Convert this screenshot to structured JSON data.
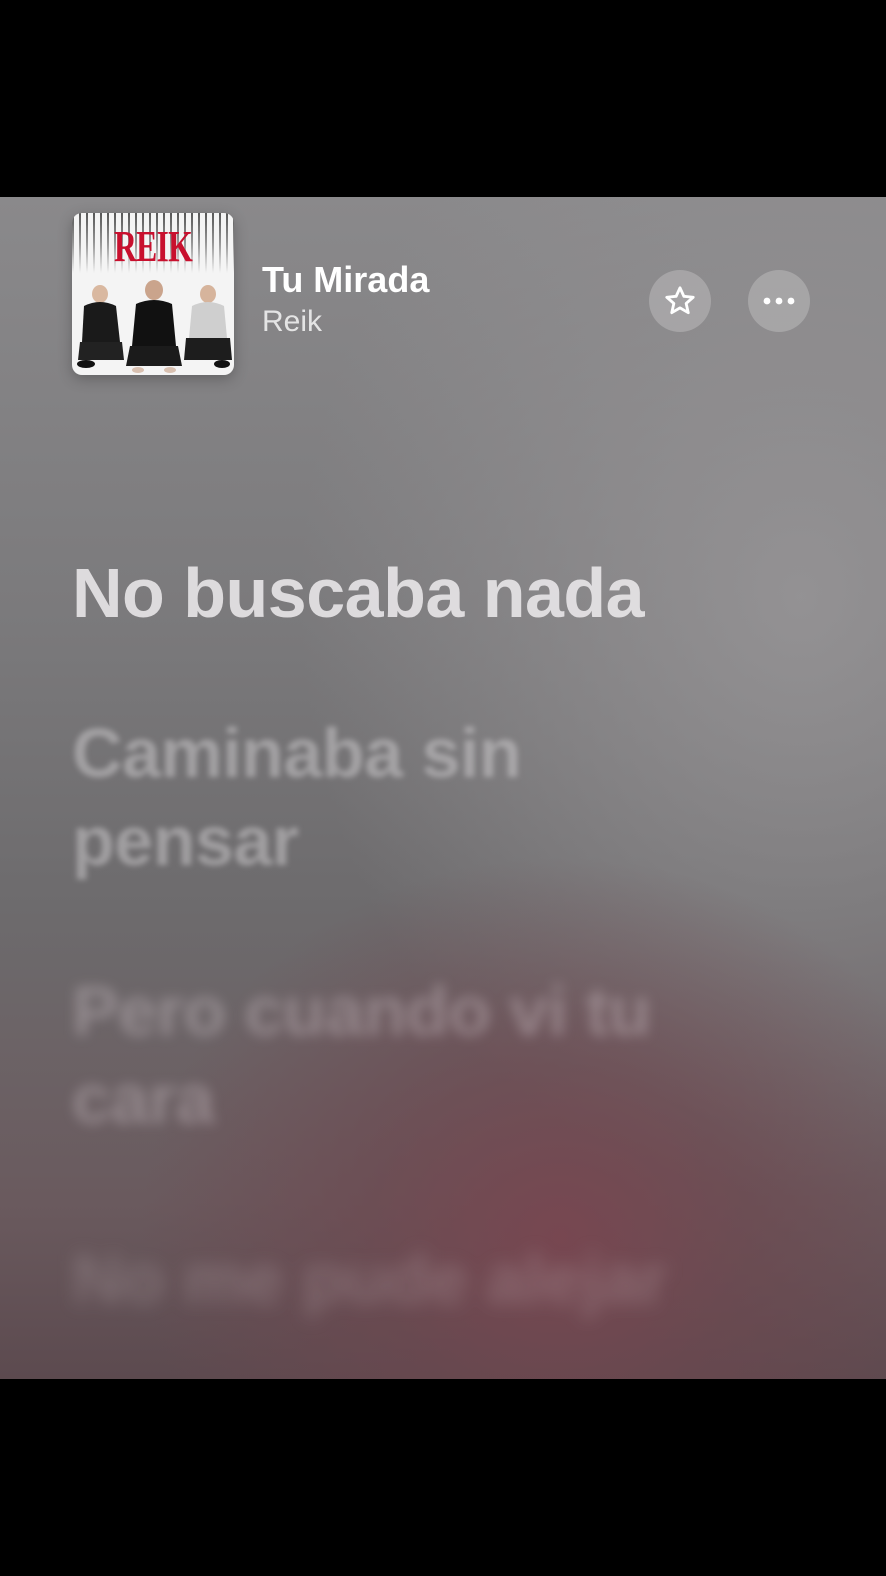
{
  "track": {
    "title": "Tu Mirada",
    "artist": "Reik",
    "artwork": {
      "brand_text": "REIK",
      "brand_color": "#c8102e"
    }
  },
  "actions": {
    "favorite_icon": "star-outline-icon",
    "more_icon": "ellipsis-icon"
  },
  "lyrics": {
    "lines": [
      "No buscaba nada",
      "Caminaba sin pensar",
      "Pero cuando vi tu cara",
      "No me pude alejar"
    ],
    "active_index": 0
  }
}
